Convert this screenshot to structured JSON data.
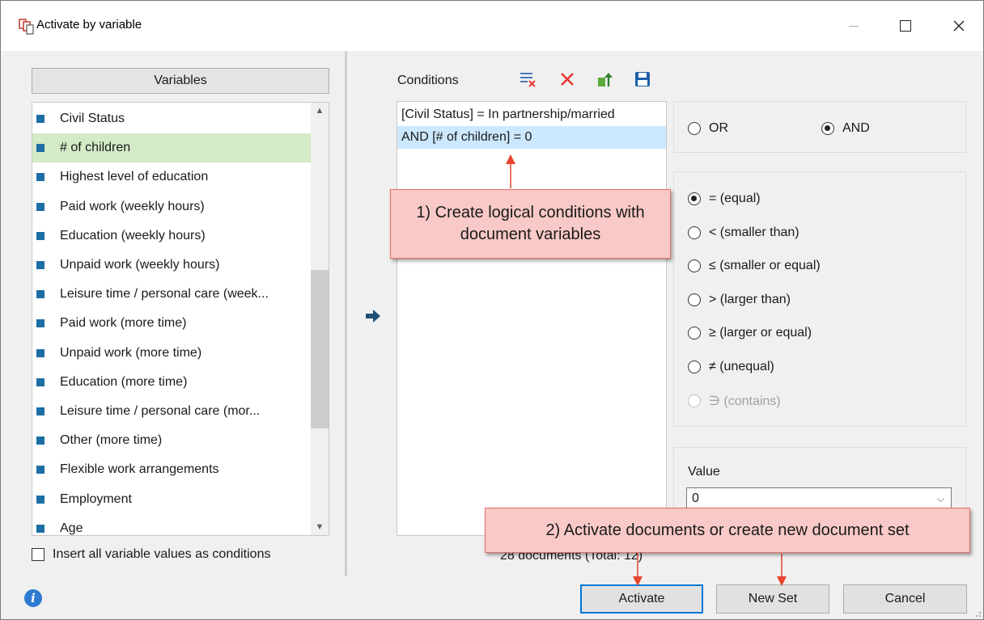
{
  "window": {
    "title": "Activate by variable",
    "minimize_icon": "minimize-icon",
    "maximize_icon": "maximize-icon",
    "close_label": "✕"
  },
  "variables": {
    "header": "Variables",
    "items": [
      {
        "label": "Civil Status",
        "selected": false
      },
      {
        "label": "# of children",
        "selected": true
      },
      {
        "label": "Highest level of education",
        "selected": false
      },
      {
        "label": "Paid work (weekly hours)",
        "selected": false
      },
      {
        "label": "Education (weekly hours)",
        "selected": false
      },
      {
        "label": "Unpaid work (weekly hours)",
        "selected": false
      },
      {
        "label": "Leisure time / personal care (week...",
        "selected": false
      },
      {
        "label": "Paid work (more time)",
        "selected": false
      },
      {
        "label": "Unpaid work (more time)",
        "selected": false
      },
      {
        "label": "Education (more time)",
        "selected": false
      },
      {
        "label": "Leisure time / personal care (mor...",
        "selected": false
      },
      {
        "label": "Other (more time)",
        "selected": false
      },
      {
        "label": "Flexible work arrangements",
        "selected": false
      },
      {
        "label": "Employment",
        "selected": false
      },
      {
        "label": "Age",
        "selected": false
      }
    ],
    "bullet_color": "#1c6ea4",
    "selected_color": "#d3ebc6",
    "insert_all_label": "Insert all variable values as conditions"
  },
  "conditions": {
    "label": "Conditions",
    "toolbar_icons": [
      "clear-conditions-icon",
      "delete-icon",
      "export-icon",
      "save-icon"
    ],
    "lines": [
      {
        "text": "[Civil Status] = In partnership/married",
        "selected": false
      },
      {
        "text": "AND [# of children] = 0",
        "selected": true
      }
    ],
    "document_count": "28 documents (Total: 12)"
  },
  "logic": {
    "or_label": "OR",
    "and_label": "AND",
    "selected": "AND"
  },
  "operators": [
    {
      "label": "= (equal)",
      "checked": true,
      "disabled": false
    },
    {
      "label": "< (smaller than)",
      "checked": false,
      "disabled": false
    },
    {
      "label": "≤ (smaller or equal)",
      "checked": false,
      "disabled": false
    },
    {
      "label": "> (larger than)",
      "checked": false,
      "disabled": false
    },
    {
      "label": "≥ (larger or equal)",
      "checked": false,
      "disabled": false
    },
    {
      "label": "≠ (unequal)",
      "checked": false,
      "disabled": false
    },
    {
      "label": "∋ (contains)",
      "checked": false,
      "disabled": true
    }
  ],
  "value": {
    "label": "Value",
    "current": "0"
  },
  "buttons": {
    "activate": "Activate",
    "new_set": "New Set",
    "cancel": "Cancel"
  },
  "callouts": {
    "one": "1) Create logical conditions with document variables",
    "two": "2) Activate documents or create new document set"
  },
  "colors": {
    "accent": "#0078d7",
    "callout_fill": "#f8c9c6",
    "callout_border": "#e26f66",
    "annotation_arrow": "#e8432e",
    "condition_selected": "#cce8ff"
  }
}
